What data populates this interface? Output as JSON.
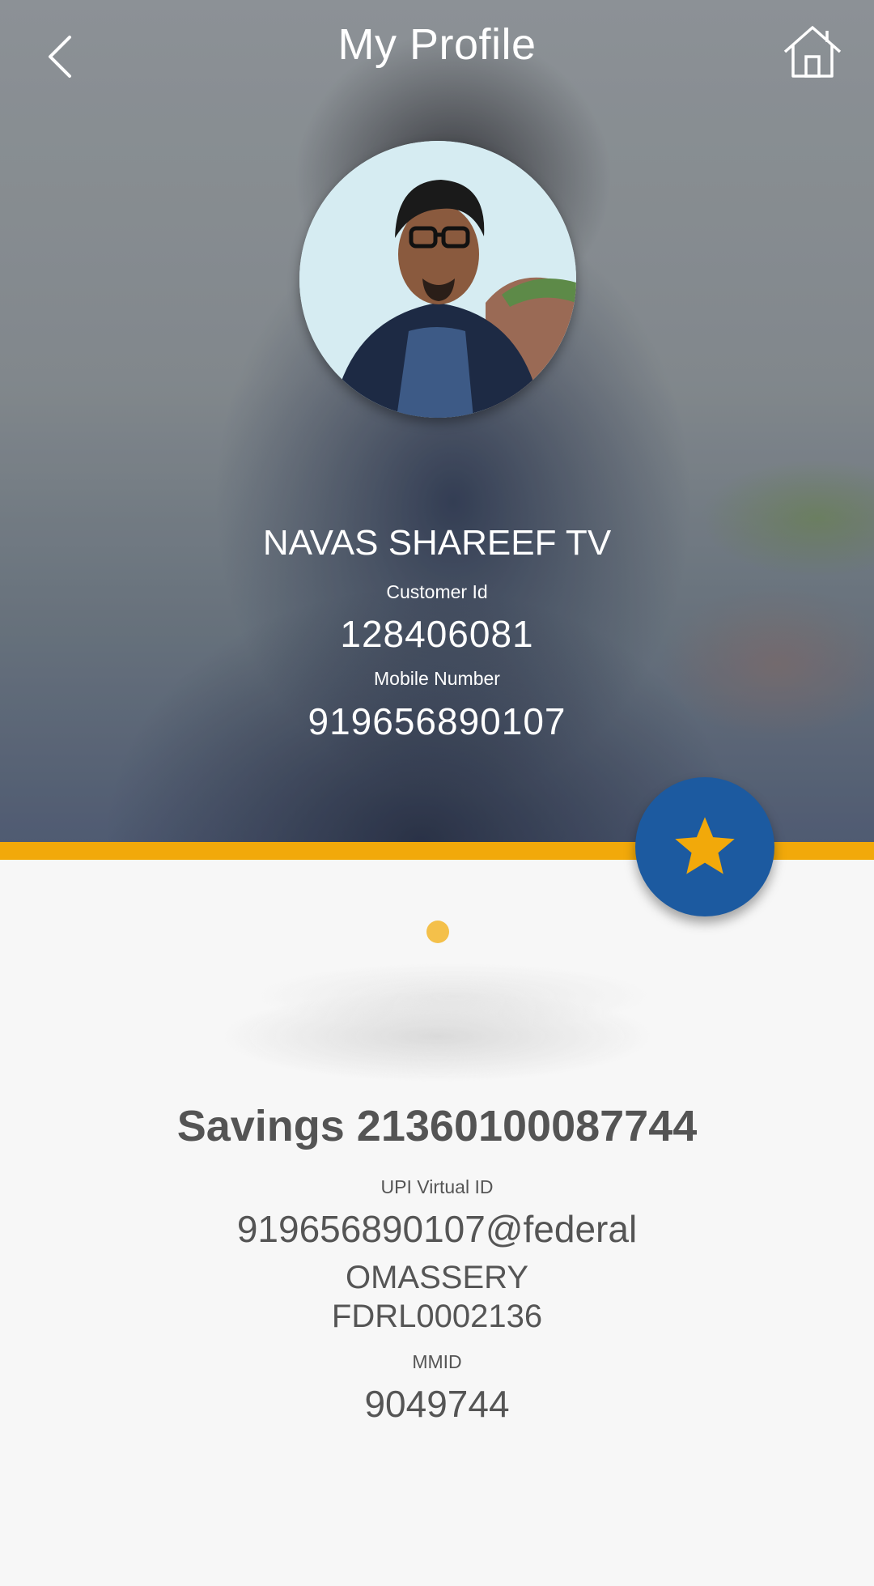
{
  "header": {
    "title": "My Profile",
    "back_icon": "chevron-left-icon",
    "home_icon": "home-icon"
  },
  "profile": {
    "name": "NAVAS SHAREEF TV",
    "customer_id_label": "Customer Id",
    "customer_id": "128406081",
    "mobile_label": "Mobile Number",
    "mobile": "919656890107"
  },
  "favorite": {
    "icon": "star-icon"
  },
  "account": {
    "title": "Savings 21360100087744",
    "upi_label": "UPI Virtual ID",
    "upi_id": "919656890107@federal",
    "branch": "OMASSERY",
    "ifsc": "FDRL0002136",
    "mmid_label": "MMID",
    "mmid": "9049744"
  },
  "colors": {
    "accent_gold": "#f2a90a",
    "fab_blue": "#1c5aa0",
    "star_gold": "#f2a90a",
    "text_dark": "#545454"
  }
}
